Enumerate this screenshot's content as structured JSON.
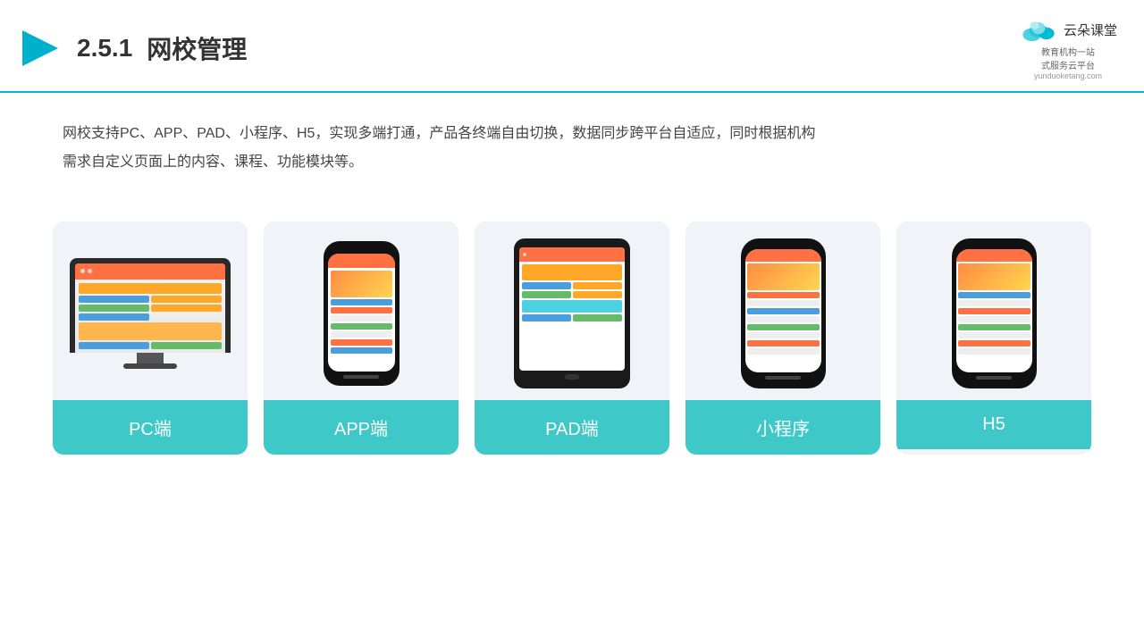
{
  "header": {
    "section_number": "2.5.1",
    "title": "网校管理",
    "logo": {
      "brand": "云朵课堂",
      "tagline": "教育机构一站\n式服务云平台",
      "url": "yunduoketang.com"
    }
  },
  "description": "网校支持PC、APP、PAD、小程序、H5，实现多端打通，产品各终端自由切换，数据同步跨平台自适应，同时根据机构\n需求自定义页面上的内容、课程、功能模块等。",
  "cards": [
    {
      "id": "pc",
      "label": "PC端"
    },
    {
      "id": "app",
      "label": "APP端"
    },
    {
      "id": "pad",
      "label": "PAD端"
    },
    {
      "id": "miniprogram",
      "label": "小程序"
    },
    {
      "id": "h5",
      "label": "H5"
    }
  ],
  "accent_color": "#3ec8c8"
}
